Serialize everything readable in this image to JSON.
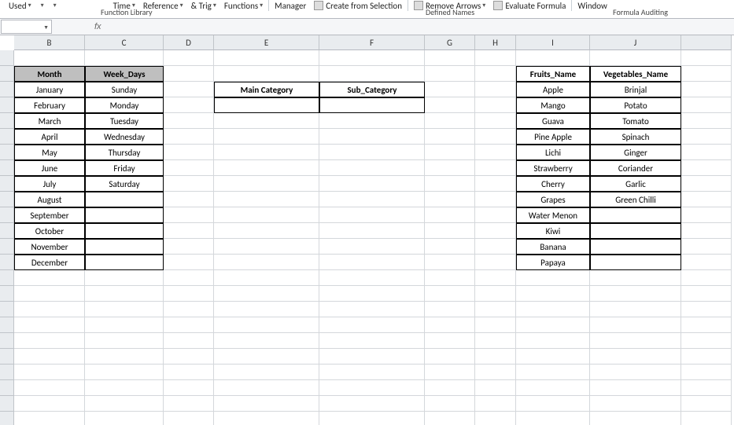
{
  "ribbon": {
    "items": {
      "used": "Used",
      "time": "Time",
      "reference": "Reference",
      "trig": "& Trig",
      "functions": "Functions",
      "manager": "Manager",
      "create_from_selection": "Create from Selection",
      "remove_arrows": "Remove Arrows",
      "evaluate_formula": "Evaluate Formula",
      "window": "Window"
    },
    "groups": {
      "function_library": "Function Library",
      "defined_names": "Defined Names",
      "formula_auditing": "Formula Auditing"
    }
  },
  "formula_bar": {
    "fx": "fx",
    "value": ""
  },
  "col_headers": [
    "B",
    "C",
    "D",
    "E",
    "F",
    "G",
    "H",
    "I",
    "J"
  ],
  "tables": {
    "months_weekdays": {
      "h1": "Month",
      "h2": "Week_Days",
      "months": [
        "January",
        "February",
        "March",
        "April",
        "May",
        "June",
        "July",
        "August",
        "September",
        "October",
        "November",
        "December"
      ],
      "days": [
        "Sunday",
        "Monday",
        "Tuesday",
        "Wednesday",
        "Thursday",
        "Friday",
        "Saturday"
      ]
    },
    "category": {
      "h1": "Main Category",
      "h2": "Sub_Category"
    },
    "fruits_veg": {
      "h1": "Fruits_Name",
      "h2": "Vegetables_Name",
      "fruits": [
        "Apple",
        "Mango",
        "Guava",
        "Pine Apple",
        "Lichi",
        "Strawberry",
        "Cherry",
        "Grapes",
        "Water Menon",
        "Kiwi",
        "Banana",
        "Papaya"
      ],
      "veg": [
        "Brinjal",
        "Potato",
        "Tomato",
        "Spinach",
        "Ginger",
        "Coriander",
        "Garlic",
        "Green Chilli"
      ]
    }
  }
}
